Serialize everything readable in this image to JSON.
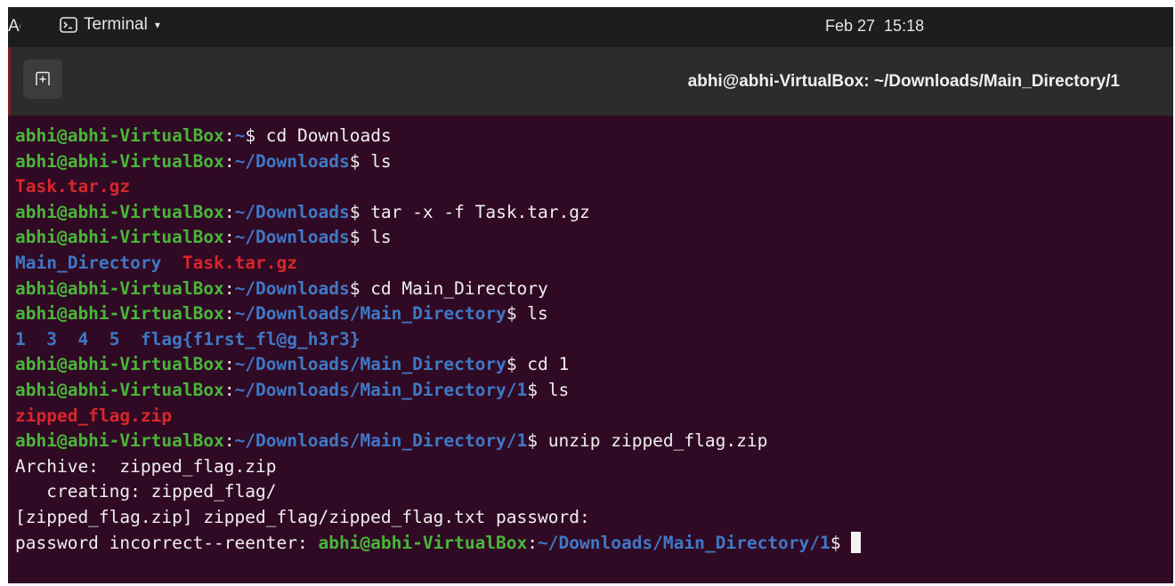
{
  "topbar": {
    "activities_label": "Activities",
    "app_name": "Terminal",
    "app_menu_arrow": "▾",
    "clock": "Feb 27  15:18"
  },
  "window": {
    "title": "abhi@abhi-VirtualBox: ~/Downloads/Main_Directory/1"
  },
  "prompt_user": "abhi@abhi-VirtualBox",
  "colors": {
    "terminal_bg": "#300a24",
    "prompt_user": "#4ab63a",
    "prompt_path": "#3f78c6",
    "archive": "#d8262b",
    "directory": "#3f78c6",
    "text": "#efefef"
  },
  "lines": [
    {
      "kind": "prompt",
      "path": "~",
      "cmd": " cd Downloads"
    },
    {
      "kind": "prompt",
      "path": "~/Downloads",
      "cmd": " ls"
    },
    {
      "kind": "output",
      "parts": [
        {
          "t": "Task.tar.gz",
          "c": "arch"
        }
      ]
    },
    {
      "kind": "prompt",
      "path": "~/Downloads",
      "cmd": " tar -x -f Task.tar.gz"
    },
    {
      "kind": "prompt",
      "path": "~/Downloads",
      "cmd": " ls"
    },
    {
      "kind": "output",
      "parts": [
        {
          "t": "Main_Directory",
          "c": "dir"
        },
        {
          "t": "  ",
          "c": "plain"
        },
        {
          "t": "Task.tar.gz",
          "c": "arch"
        }
      ]
    },
    {
      "kind": "prompt",
      "path": "~/Downloads",
      "cmd": " cd Main_Directory"
    },
    {
      "kind": "prompt",
      "path": "~/Downloads/Main_Directory",
      "cmd": " ls"
    },
    {
      "kind": "output",
      "parts": [
        {
          "t": "1",
          "c": "dir"
        },
        {
          "t": "  ",
          "c": "plain"
        },
        {
          "t": "3",
          "c": "dir"
        },
        {
          "t": "  ",
          "c": "plain"
        },
        {
          "t": "4",
          "c": "dir"
        },
        {
          "t": "  ",
          "c": "plain"
        },
        {
          "t": "5",
          "c": "dir"
        },
        {
          "t": "  ",
          "c": "plain"
        },
        {
          "t": "flag{f1rst_fl@g_h3r3}",
          "c": "dir"
        }
      ]
    },
    {
      "kind": "prompt",
      "path": "~/Downloads/Main_Directory",
      "cmd": " cd 1"
    },
    {
      "kind": "prompt",
      "path": "~/Downloads/Main_Directory/1",
      "cmd": " ls"
    },
    {
      "kind": "output",
      "parts": [
        {
          "t": "zipped_flag.zip",
          "c": "arch"
        }
      ]
    },
    {
      "kind": "prompt",
      "path": "~/Downloads/Main_Directory/1",
      "cmd": " unzip zipped_flag.zip"
    },
    {
      "kind": "output",
      "parts": [
        {
          "t": "Archive:  zipped_flag.zip",
          "c": "plain"
        }
      ]
    },
    {
      "kind": "output",
      "parts": [
        {
          "t": "   creating: zipped_flag/",
          "c": "plain"
        }
      ]
    },
    {
      "kind": "output",
      "parts": [
        {
          "t": "[zipped_flag.zip] zipped_flag/zipped_flag.txt password: ",
          "c": "plain"
        }
      ]
    },
    {
      "kind": "mixed",
      "pre": "password incorrect--reenter: ",
      "path": "~/Downloads/Main_Directory/1",
      "cmd": " ",
      "cursor": true
    }
  ]
}
